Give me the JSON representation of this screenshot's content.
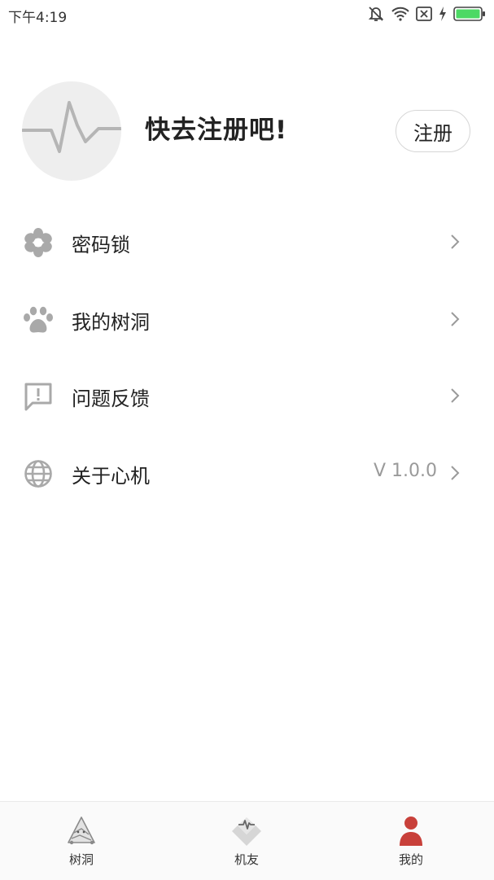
{
  "status_bar": {
    "time": "下午4:19"
  },
  "profile": {
    "title": "快去注册吧!",
    "register_label": "注册"
  },
  "menu": {
    "items": [
      {
        "label": "密码锁",
        "value": "",
        "icon": "flower-icon"
      },
      {
        "label": "我的树洞",
        "value": "",
        "icon": "paw-icon"
      },
      {
        "label": "问题反馈",
        "value": "",
        "icon": "feedback-icon"
      },
      {
        "label": "关于心机",
        "value": "V 1.0.0",
        "icon": "globe-icon"
      }
    ]
  },
  "tabbar": {
    "tabs": [
      {
        "label": "树洞",
        "icon": "tree-hole-icon",
        "active": false
      },
      {
        "label": "机友",
        "icon": "heart-pulse-icon",
        "active": false
      },
      {
        "label": "我的",
        "icon": "person-icon",
        "active": true
      }
    ]
  },
  "colors": {
    "accent": "#c8403a",
    "icon_gray": "#a9a9a9",
    "avatar_bg": "#eeeeee"
  }
}
